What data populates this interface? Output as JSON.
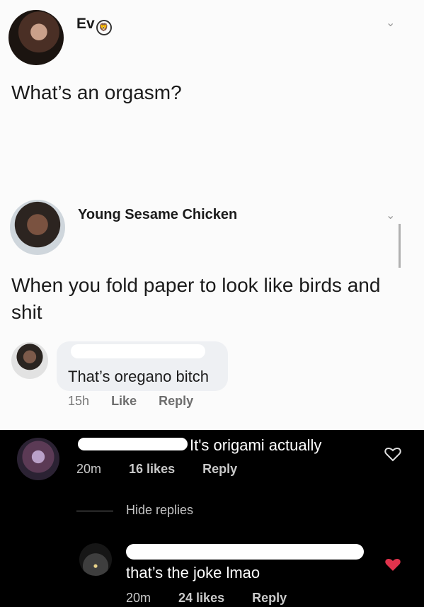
{
  "post1": {
    "author": "Ev",
    "badge_icon": "lion-icon",
    "text": "What’s an orgasm?"
  },
  "post2": {
    "author": "Young Sesame Chicken",
    "text": "When you fold paper to look like birds and shit"
  },
  "comment1": {
    "text": "That’s oregano bitch",
    "time": "15h",
    "like": "Like",
    "reply": "Reply"
  },
  "comment2": {
    "text": "It's origami actually",
    "time": "20m",
    "likes": "16 likes",
    "reply": "Reply"
  },
  "hide_replies": "Hide replies",
  "comment3": {
    "text": "that’s the joke lmao",
    "time": "20m",
    "likes": "24 likes",
    "reply": "Reply"
  },
  "colors": {
    "dark_bg": "#000000",
    "heart_red": "#e0334c"
  }
}
